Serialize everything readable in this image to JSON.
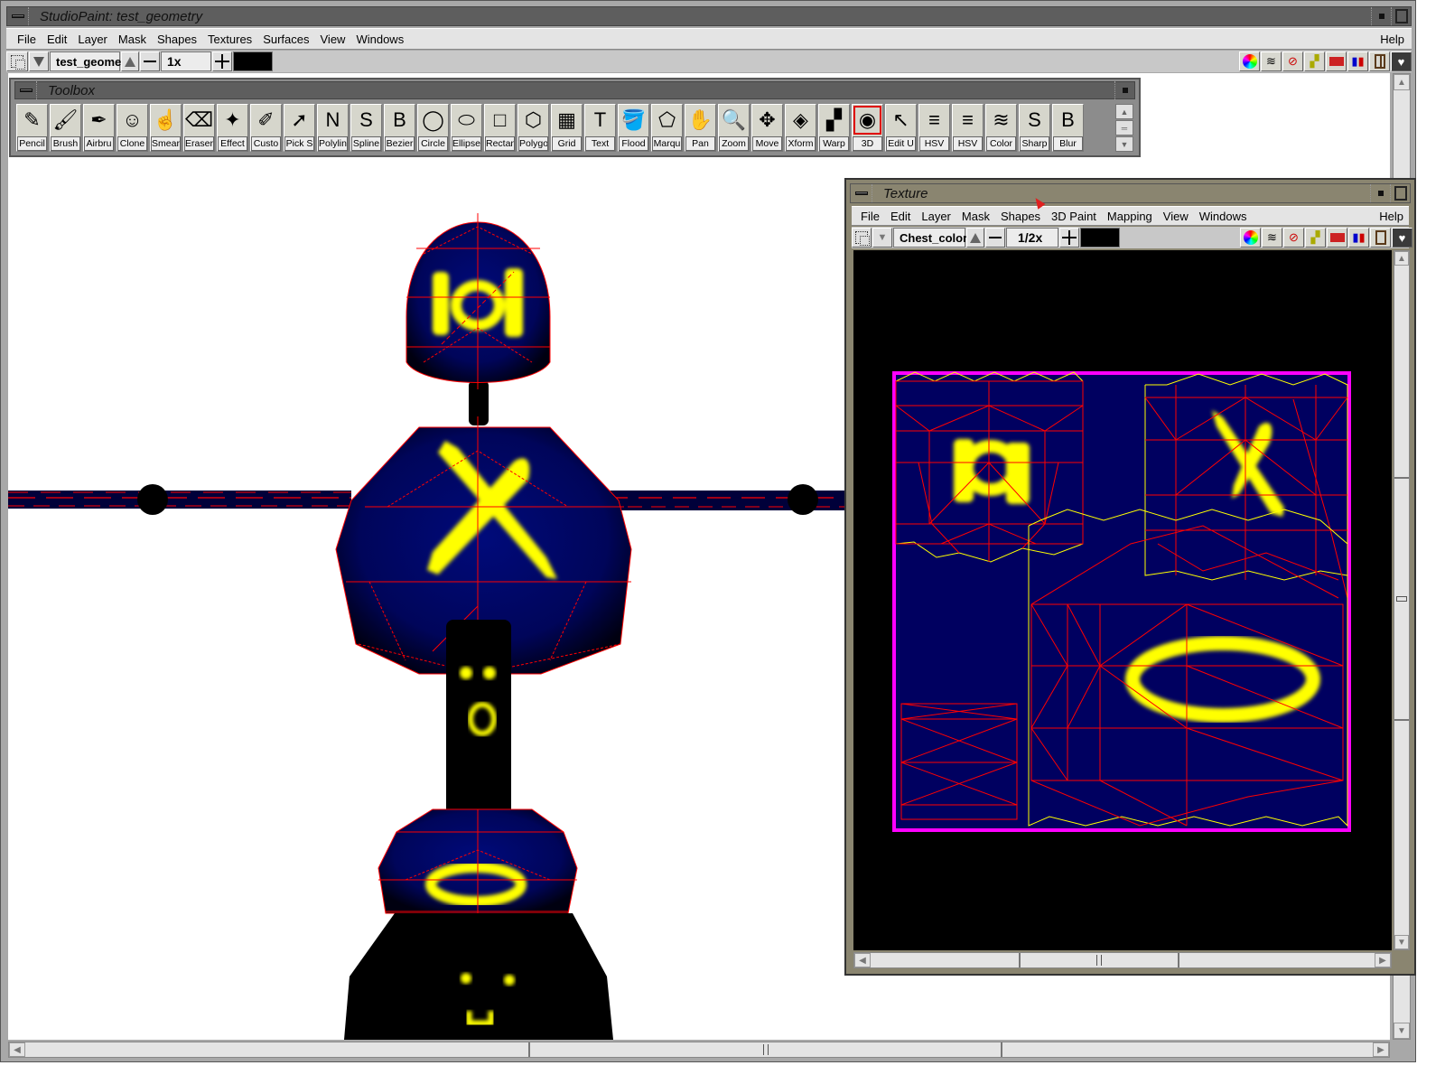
{
  "main_window": {
    "title": "StudioPaint: test_geometry",
    "menu": [
      "File",
      "Edit",
      "Layer",
      "Mask",
      "Shapes",
      "Textures",
      "Surfaces",
      "View",
      "Windows"
    ],
    "help_label": "Help",
    "image_name": "test_geome",
    "zoom_level": "1x",
    "current_color": "#000000",
    "palette_icons": [
      "color-wheel-icon",
      "layers-icon",
      "hammer-icon",
      "brushes-icon",
      "toolbox-chest-icon",
      "paint-shelf-icon",
      "window-icon",
      "heart-check-icon"
    ],
    "h_scroll_position": 0.5,
    "v_scroll_position": 0.5
  },
  "toolbox": {
    "title": "Toolbox",
    "tools": [
      {
        "label": "Pencil",
        "icon": "pencil-icon",
        "glyph": "✎"
      },
      {
        "label": "Brush",
        "icon": "brush-icon",
        "glyph": "🖌"
      },
      {
        "label": "Airbru",
        "icon": "airbrush-icon",
        "glyph": "✒"
      },
      {
        "label": "Clone",
        "icon": "clone-icon",
        "glyph": "☺"
      },
      {
        "label": "Smear",
        "icon": "smear-icon",
        "glyph": "☝"
      },
      {
        "label": "Eraser",
        "icon": "eraser-icon",
        "glyph": "⌫"
      },
      {
        "label": "Effect",
        "icon": "effect-brush-icon",
        "glyph": "✦"
      },
      {
        "label": "Custo",
        "icon": "custom-brush-icon",
        "glyph": "✐"
      },
      {
        "label": "Pick S",
        "icon": "pick-arrow-icon",
        "glyph": "➚"
      },
      {
        "label": "Polylin",
        "icon": "polyline-icon",
        "glyph": "N"
      },
      {
        "label": "Spline",
        "icon": "spline-icon",
        "glyph": "S"
      },
      {
        "label": "Bezier",
        "icon": "bezier-icon",
        "glyph": "B"
      },
      {
        "label": "Circle",
        "icon": "circle-icon",
        "glyph": "◯"
      },
      {
        "label": "Ellipse",
        "icon": "ellipse-icon",
        "glyph": "⬭"
      },
      {
        "label": "Rectan",
        "icon": "rectangle-icon",
        "glyph": "□"
      },
      {
        "label": "Polygo",
        "icon": "polygon-icon",
        "glyph": "⬡"
      },
      {
        "label": "Grid",
        "icon": "grid-icon",
        "glyph": "▦"
      },
      {
        "label": "Text",
        "icon": "text-icon",
        "glyph": "T"
      },
      {
        "label": "Flood",
        "icon": "flood-fill-icon",
        "glyph": "🪣"
      },
      {
        "label": "Marqu",
        "icon": "marquee-icon",
        "glyph": "⬠"
      },
      {
        "label": "Pan",
        "icon": "pan-hand-icon",
        "glyph": "✋"
      },
      {
        "label": "Zoom",
        "icon": "zoom-magnifier-icon",
        "glyph": "🔍"
      },
      {
        "label": "Move",
        "icon": "move-arrows-icon",
        "glyph": "✥"
      },
      {
        "label": "Xform",
        "icon": "transform-icon",
        "glyph": "◈"
      },
      {
        "label": "Warp",
        "icon": "warp-checker-icon",
        "glyph": "▞"
      },
      {
        "label": "3D",
        "icon": "3d-paint-icon",
        "glyph": "◉"
      },
      {
        "label": "Edit U",
        "icon": "edit-uv-icon",
        "glyph": "↖"
      },
      {
        "label": "HSV",
        "icon": "hsv-icon",
        "glyph": "≡"
      },
      {
        "label": "HSV",
        "icon": "hsv-mask-icon",
        "glyph": "≡"
      },
      {
        "label": "Color",
        "icon": "color-curves-icon",
        "glyph": "≋"
      },
      {
        "label": "Sharp",
        "icon": "sharpen-icon",
        "glyph": "S"
      },
      {
        "label": "Blur",
        "icon": "blur-icon",
        "glyph": "B"
      }
    ],
    "active_tool": "3D"
  },
  "texture_window": {
    "title": "Texture",
    "menu": [
      "File",
      "Edit",
      "Layer",
      "Mask",
      "Shapes",
      "3D Paint",
      "Mapping",
      "View",
      "Windows"
    ],
    "help_label": "Help",
    "texture_name": "Chest_color",
    "zoom_level": "1/2x",
    "current_color": "#000000"
  },
  "colors": {
    "texture_bg": "#000060",
    "wireframe": "#ff0000",
    "uv_border": "#ffff00",
    "texture_frame": "#ff00ff",
    "paint": "#ffff00",
    "texture_title_bg": "#8a8570",
    "main_title_bg": "#5e5e5e"
  }
}
